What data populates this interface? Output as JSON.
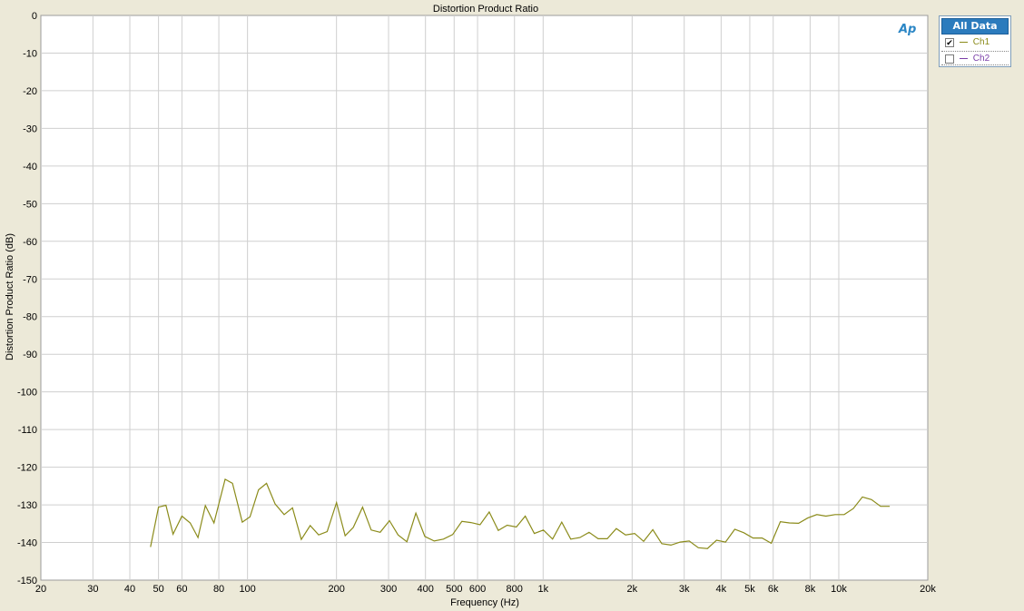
{
  "chart_data": {
    "type": "line",
    "title": "Distortion Product Ratio",
    "xlabel": "Frequency (Hz)",
    "ylabel": "Distortion Product Ratio (dB)",
    "xscale": "log",
    "xlim": [
      20,
      20000
    ],
    "ylim": [
      -150,
      0
    ],
    "grid": true,
    "legend_position": "top-right",
    "x_ticks": [
      {
        "value": 20,
        "label": "20"
      },
      {
        "value": 30,
        "label": "30"
      },
      {
        "value": 40,
        "label": "40"
      },
      {
        "value": 50,
        "label": "50"
      },
      {
        "value": 60,
        "label": "60"
      },
      {
        "value": 80,
        "label": "80"
      },
      {
        "value": 100,
        "label": "100"
      },
      {
        "value": 200,
        "label": "200"
      },
      {
        "value": 300,
        "label": "300"
      },
      {
        "value": 400,
        "label": "400"
      },
      {
        "value": 500,
        "label": "500"
      },
      {
        "value": 600,
        "label": "600"
      },
      {
        "value": 800,
        "label": "800"
      },
      {
        "value": 1000,
        "label": "1k"
      },
      {
        "value": 2000,
        "label": "2k"
      },
      {
        "value": 3000,
        "label": "3k"
      },
      {
        "value": 4000,
        "label": "4k"
      },
      {
        "value": 5000,
        "label": "5k"
      },
      {
        "value": 6000,
        "label": "6k"
      },
      {
        "value": 8000,
        "label": "8k"
      },
      {
        "value": 10000,
        "label": "10k"
      },
      {
        "value": 20000,
        "label": "20k"
      }
    ],
    "y_ticks": [
      {
        "value": 0,
        "label": "0"
      },
      {
        "value": -10,
        "label": "-10"
      },
      {
        "value": -20,
        "label": "-20"
      },
      {
        "value": -30,
        "label": "-30"
      },
      {
        "value": -40,
        "label": "-40"
      },
      {
        "value": -50,
        "label": "-50"
      },
      {
        "value": -60,
        "label": "-60"
      },
      {
        "value": -70,
        "label": "-70"
      },
      {
        "value": -80,
        "label": "-80"
      },
      {
        "value": -90,
        "label": "-90"
      },
      {
        "value": -100,
        "label": "-100"
      },
      {
        "value": -110,
        "label": "-110"
      },
      {
        "value": -120,
        "label": "-120"
      },
      {
        "value": -130,
        "label": "-130"
      },
      {
        "value": -140,
        "label": "-140"
      },
      {
        "value": -150,
        "label": "-150"
      }
    ],
    "series": [
      {
        "name": "Ch1",
        "color": "#8b8b1a",
        "visible": true,
        "x": [
          47,
          50,
          53,
          56,
          60,
          64,
          68,
          72,
          77,
          84,
          89,
          96,
          102,
          109,
          116,
          124,
          133,
          142,
          152,
          163,
          174,
          186,
          200,
          214,
          228,
          245,
          262,
          281,
          302,
          323,
          346,
          371,
          398,
          428,
          460,
          494,
          531,
          570,
          612,
          657,
          705,
          756,
          812,
          870,
          934,
          1002,
          1076,
          1156,
          1240,
          1332,
          1430,
          1535,
          1647,
          1768,
          1900,
          2040,
          2188,
          2350,
          2520,
          2707,
          2906,
          3120,
          3350,
          3596,
          3860,
          4140,
          4450,
          4775,
          5128,
          5505,
          5910,
          6345,
          6810,
          7312,
          7850,
          8430,
          9050,
          9715,
          10430,
          11195,
          12020,
          12900,
          13850,
          14870
        ],
        "y": [
          -141.2,
          -130.6,
          -130.1,
          -137.8,
          -133.0,
          -134.8,
          -138.7,
          -130.2,
          -134.8,
          -123.2,
          -124.3,
          -134.6,
          -133.2,
          -126.0,
          -124.3,
          -129.8,
          -132.6,
          -130.8,
          -139.2,
          -135.5,
          -138.0,
          -137.1,
          -129.4,
          -138.2,
          -136.0,
          -130.6,
          -136.7,
          -137.3,
          -134.2,
          -138.0,
          -139.8,
          -132.2,
          -138.4,
          -139.6,
          -139.1,
          -137.9,
          -134.4,
          -134.7,
          -135.3,
          -131.9,
          -136.8,
          -135.4,
          -135.9,
          -133.0,
          -137.6,
          -136.7,
          -139.1,
          -134.6,
          -139.1,
          -138.7,
          -137.3,
          -139.0,
          -139.0,
          -136.3,
          -138.0,
          -137.6,
          -139.7,
          -136.6,
          -140.3,
          -140.7,
          -139.9,
          -139.6,
          -141.4,
          -141.6,
          -139.4,
          -139.9,
          -136.5,
          -137.4,
          -138.8,
          -138.8,
          -140.2,
          -134.5,
          -134.8,
          -134.9,
          -133.5,
          -132.6,
          -133.0,
          -132.6,
          -132.6,
          -131.0,
          -127.9,
          -128.6,
          -130.4,
          -130.4
        ]
      },
      {
        "name": "Ch2",
        "color": "#7b3fa8",
        "visible": false,
        "x": [],
        "y": []
      }
    ]
  },
  "legend": {
    "header": "All Data",
    "items": [
      {
        "label": "Ch1",
        "checked": true,
        "color": "#8b8b1a"
      },
      {
        "label": "Ch2",
        "checked": false,
        "color": "#7b3fa8"
      }
    ]
  },
  "logo": {
    "text": "Ap"
  },
  "colors": {
    "background": "#ece9d8",
    "plot_background": "#ffffff",
    "grid": "#cfcfcf"
  }
}
